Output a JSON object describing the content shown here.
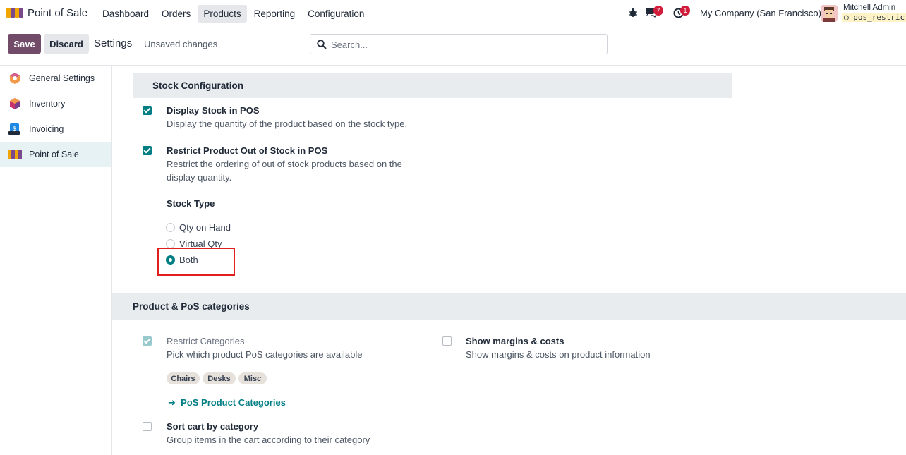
{
  "app": {
    "name": "Point of Sale"
  },
  "menu": [
    "Dashboard",
    "Orders",
    "Products",
    "Reporting",
    "Configuration"
  ],
  "active_menu": "Products",
  "nav": {
    "messages_count": "7",
    "activities_count": "1",
    "company": "My Company (San Francisco)",
    "user_name": "Mitchell Admin",
    "database": "pos_restrict"
  },
  "control_panel": {
    "save_label": "Save",
    "discard_label": "Discard",
    "title": "Settings",
    "status": "Unsaved changes",
    "search_placeholder": "Search..."
  },
  "sidebar": {
    "items": [
      {
        "label": "General Settings",
        "icon": "general-settings-icon",
        "active": false
      },
      {
        "label": "Inventory",
        "icon": "inventory-icon",
        "active": false
      },
      {
        "label": "Invoicing",
        "icon": "invoicing-icon",
        "active": false
      },
      {
        "label": "Point of Sale",
        "icon": "point-of-sale-icon",
        "active": true
      }
    ]
  },
  "stock_section": {
    "title": "Stock Configuration",
    "display_stock": {
      "title": "Display Stock in POS",
      "description": "Display the quantity of the product based on the stock type.",
      "checked": true
    },
    "restrict_stock": {
      "title": "Restrict Product Out of Stock in POS",
      "description": "Restrict the ordering of out of stock products based on the display quantity.",
      "checked": true
    },
    "stock_type": {
      "label": "Stock Type",
      "options": [
        "Qty on Hand",
        "Virtual Qty",
        "Both"
      ],
      "selected": "Both"
    }
  },
  "categories_section": {
    "title": "Product & PoS categories",
    "restrict_categories": {
      "title": "Restrict Categories",
      "description": "Pick which product PoS categories are available",
      "checked": true,
      "tags": [
        "Chairs",
        "Desks",
        "Misc"
      ],
      "link": "PoS Product Categories"
    },
    "show_margins": {
      "title": "Show margins & costs",
      "description": "Show margins & costs on product information",
      "checked": false
    },
    "sort_cart": {
      "title": "Sort cart by category",
      "description": "Group items in the cart according to their category",
      "checked": false
    }
  },
  "colors": {
    "brand": "#714b67",
    "accent": "#017e84",
    "badge": "#d11d3b",
    "highlight": "#e0201f"
  }
}
